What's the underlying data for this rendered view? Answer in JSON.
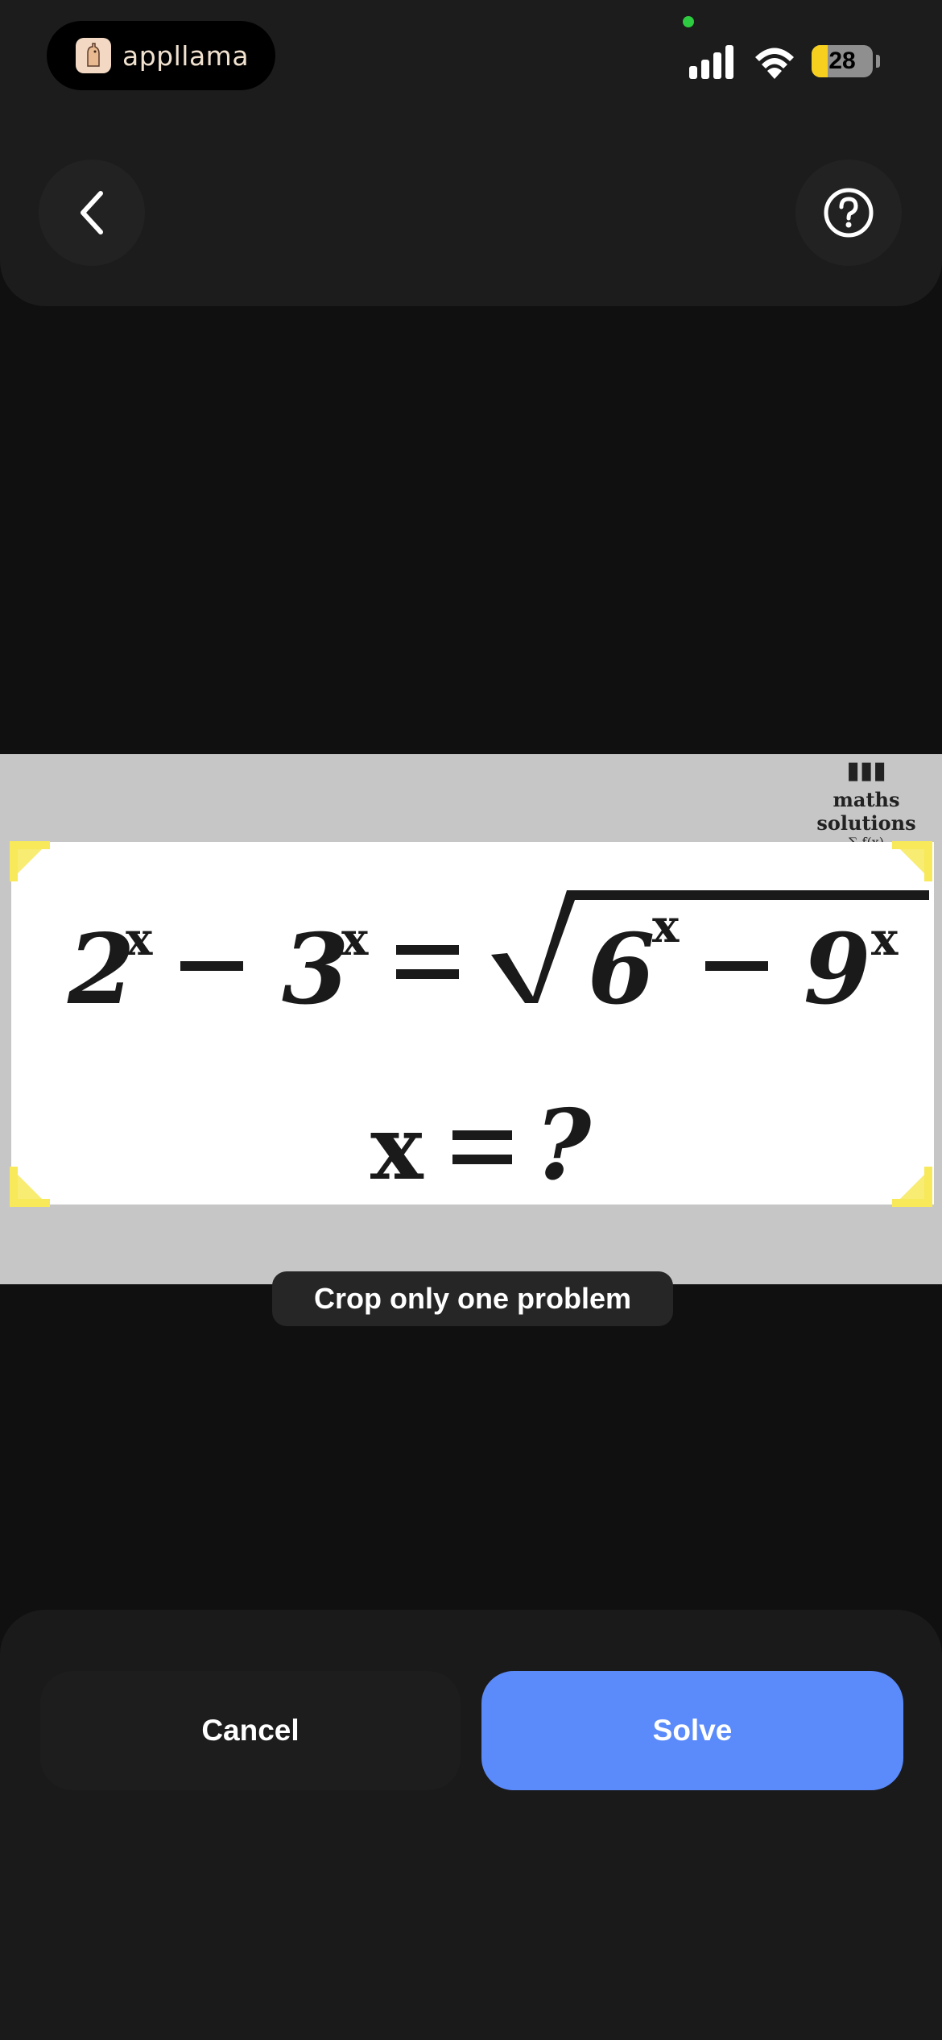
{
  "status_bar": {
    "app_name": "appllama",
    "battery": "28",
    "icons": [
      "signal-icon",
      "wifi-icon",
      "battery-icon"
    ]
  },
  "header": {
    "back_icon": "chevron-left-icon",
    "help_icon": "question-circle-icon"
  },
  "problem_image": {
    "watermark_title": "maths solutions",
    "watermark_sub": "∑ f(x)",
    "equation_line1": "2ˣ − 3ˣ = √(6ˣ − 9ˣ)",
    "equation_line2": "x = ?"
  },
  "crop_hint": "Crop only one problem",
  "actions": {
    "cancel_label": "Cancel",
    "solve_label": "Solve"
  },
  "colors": {
    "accent": "#5b8afa",
    "crop_handle": "#f7e95a",
    "background": "#101010"
  }
}
